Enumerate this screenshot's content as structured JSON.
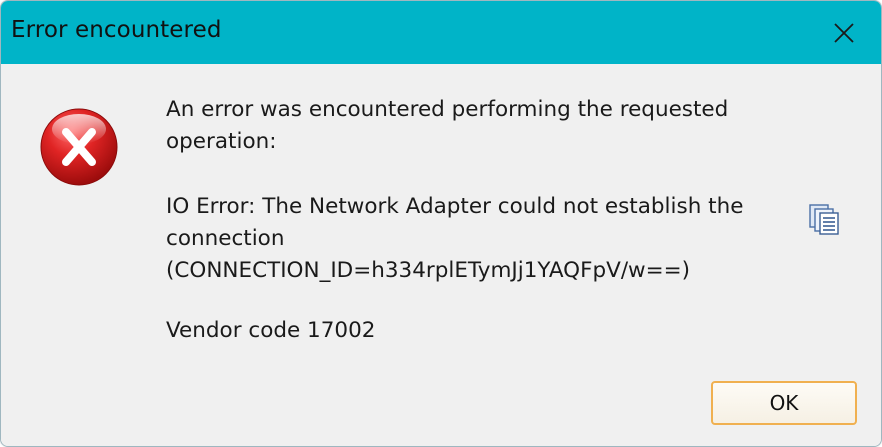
{
  "window": {
    "title": "Error encountered",
    "close_icon": "close-icon"
  },
  "content": {
    "icon": "error-icon",
    "message_intro": [
      "An error was encountered performing the requested",
      "operation:"
    ],
    "message_detail": [
      "IO Error: The Network Adapter could not establish the",
      "connection",
      "(CONNECTION_ID=h334rplETymJj1YAQFpV/w==)"
    ],
    "vendor_code": "Vendor code 17002",
    "copy_icon": "copy-icon"
  },
  "buttons": {
    "ok_label": "OK"
  },
  "colors": {
    "titlebar": "#00b4c8",
    "body": "#f0f0f0",
    "error_red": "#d91a1a",
    "ok_border": "#f0b050"
  }
}
